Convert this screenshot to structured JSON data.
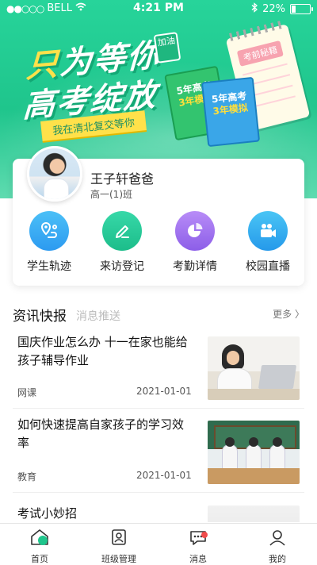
{
  "status_bar": {
    "signal_dots": "●●○○○",
    "carrier": "BELL",
    "time": "4:21 PM",
    "battery_percent": "22%",
    "battery_level": 0.22
  },
  "banner": {
    "slogan_line1_first": "只",
    "slogan_line1_rest": "为等你",
    "slogan_line2": "高考绽放",
    "tag": "加油",
    "ribbon": "我在清北复交等你",
    "book_green": [
      "5年高考",
      "3年模拟"
    ],
    "book_blue": [
      "5年高考",
      "3年模拟"
    ],
    "notebook_title": "考前秘籍"
  },
  "profile": {
    "name": "王子轩爸爸",
    "class": "高一(1)班"
  },
  "actions": [
    {
      "label": "学生轨迹",
      "icon": "location-route-icon"
    },
    {
      "label": "来访登记",
      "icon": "pen-edit-icon"
    },
    {
      "label": "考勤详情",
      "icon": "pie-chart-icon"
    },
    {
      "label": "校园直播",
      "icon": "video-camera-icon"
    }
  ],
  "news_section": {
    "title": "资讯快报",
    "subtitle": "消息推送",
    "more": "更多 〉"
  },
  "news": [
    {
      "headline": "国庆作业怎么办 十一在家也能给孩子辅导作业",
      "category": "网课",
      "date": "2021-01-01"
    },
    {
      "headline": "如何快速提高自家孩子的学习效率",
      "category": "教育",
      "date": "2021-01-01"
    },
    {
      "headline": "考试小妙招",
      "category": "",
      "date": ""
    }
  ],
  "tabbar": [
    {
      "label": "首页",
      "icon": "home-icon",
      "active": true
    },
    {
      "label": "班级管理",
      "icon": "class-management-icon",
      "active": false
    },
    {
      "label": "消息",
      "icon": "message-icon",
      "active": false,
      "badge": true
    },
    {
      "label": "我的",
      "icon": "profile-icon",
      "active": false
    }
  ],
  "colors": {
    "brand_green": "#1fc58c",
    "badge_red": "#f04b4b"
  }
}
